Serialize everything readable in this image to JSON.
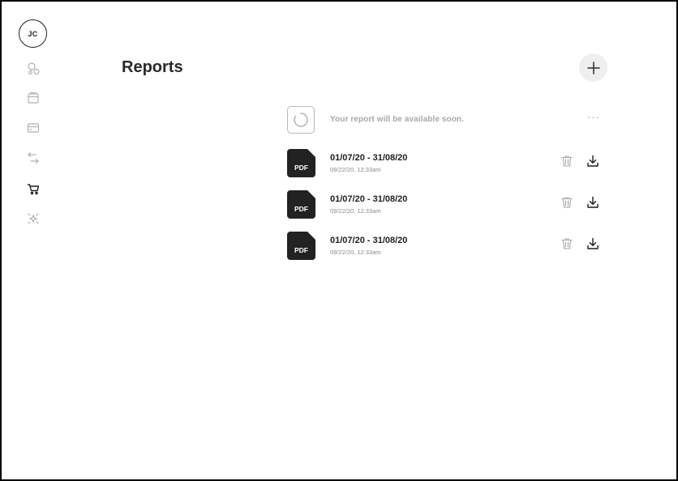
{
  "user": {
    "initials": "JC"
  },
  "sidebar": {
    "items": [
      {
        "icon": "circles-icon"
      },
      {
        "icon": "wallet-icon"
      },
      {
        "icon": "card-icon"
      },
      {
        "icon": "transfer-icon"
      },
      {
        "icon": "cart-icon",
        "active": true
      },
      {
        "icon": "sparkle-icon"
      }
    ]
  },
  "header": {
    "title": "Reports",
    "add_icon": "plus-icon"
  },
  "pending": {
    "message": "Your report will be available soon.",
    "more_label": "···"
  },
  "reports": [
    {
      "file_type": "PDF",
      "title": "01/07/20 - 31/08/20",
      "date": "09/22/20, 12:33am"
    },
    {
      "file_type": "PDF",
      "title": "01/07/20 - 31/08/20",
      "date": "09/22/20, 12:33am"
    },
    {
      "file_type": "PDF",
      "title": "01/07/20 - 31/08/20",
      "date": "09/22/20, 12:33am"
    }
  ],
  "colors": {
    "icon_muted": "#b0b0b0",
    "icon_active": "#1d1d1d",
    "file_bg": "#222222",
    "add_bg": "#efefef"
  }
}
